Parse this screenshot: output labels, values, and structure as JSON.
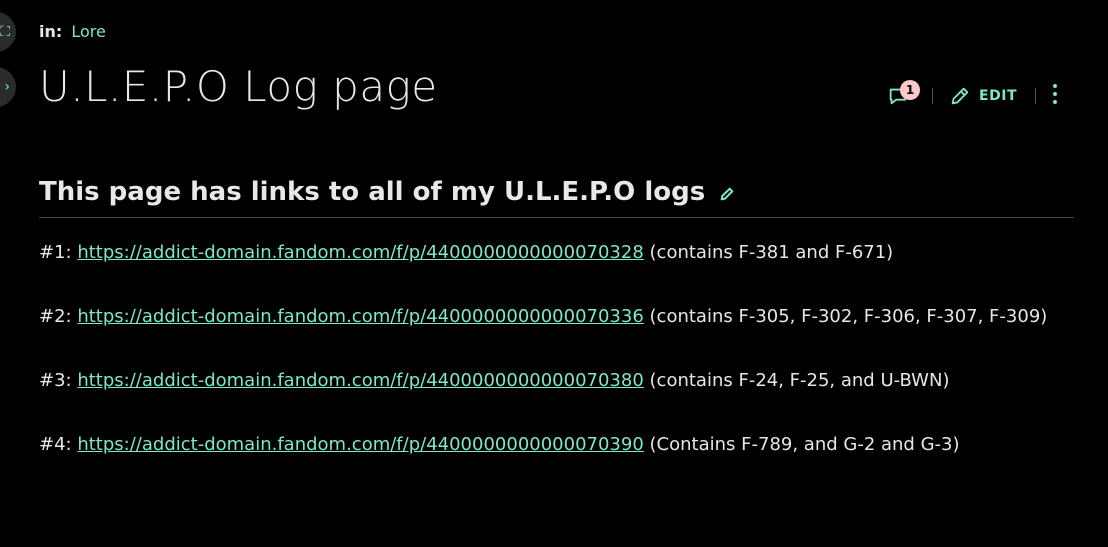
{
  "breadcrumb": {
    "prefix": "in:",
    "category": "Lore"
  },
  "page": {
    "title": "U.L.E.P.O Log page"
  },
  "actions": {
    "comment_count": "1",
    "edit_label": "EDIT"
  },
  "section": {
    "heading": "This page has links to all of my U.L.E.P.O logs"
  },
  "entries": [
    {
      "num": "#1:",
      "url": "https://addict-domain.fandom.com/f/p/4400000000000070328",
      "note": "(contains F-381 and F-671)"
    },
    {
      "num": "#2:",
      "url": "https://addict-domain.fandom.com/f/p/4400000000000070336",
      "note": "(contains F-305, F-302, F-306, F-307, F-309)"
    },
    {
      "num": "#3:",
      "url": "https://addict-domain.fandom.com/f/p/4400000000000070380",
      "note": "(contains F-24, F-25, and U-BWN)"
    },
    {
      "num": "#4:",
      "url": "https://addict-domain.fandom.com/f/p/4400000000000070390",
      "note": "(Contains F-789, and G-2 and G-3)"
    }
  ],
  "colors": {
    "accent": "#7ee8c6",
    "badge": "#ffc9c9",
    "background": "#000000"
  }
}
